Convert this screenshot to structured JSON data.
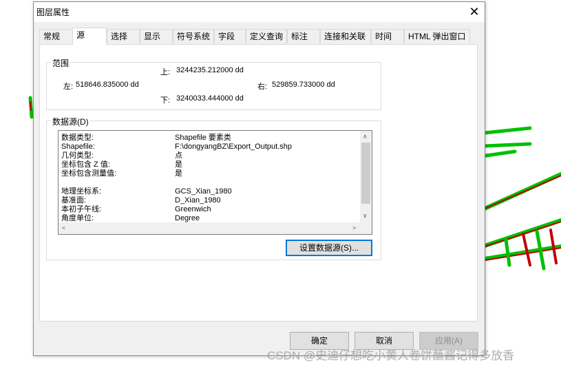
{
  "window": {
    "title": "图层属性"
  },
  "tabs": [
    {
      "label": "常规"
    },
    {
      "label": "源"
    },
    {
      "label": "选择"
    },
    {
      "label": "显示"
    },
    {
      "label": "符号系统"
    },
    {
      "label": "字段"
    },
    {
      "label": "定义查询"
    },
    {
      "label": "标注"
    },
    {
      "label": "连接和关联"
    },
    {
      "label": "时间"
    },
    {
      "label": "HTML 弹出窗口"
    }
  ],
  "active_tab": "源",
  "extent": {
    "label": "范围",
    "top_label": "上:",
    "top_value": "3244235.212000 dd",
    "left_label": "左:",
    "left_value": "518646.835000 dd",
    "right_label": "右:",
    "right_value": "529859.733000 dd",
    "bottom_label": "下:",
    "bottom_value": "3240033.444000 dd"
  },
  "datasource": {
    "label": "数据源(D)",
    "rows": [
      {
        "key": "数据类型:",
        "value": "Shapefile 要素类"
      },
      {
        "key": "Shapefile:",
        "value": "F:\\dongyangBZ\\Export_Output.shp"
      },
      {
        "key": "几何类型:",
        "value": "点"
      },
      {
        "key": "坐标包含 Z 值:",
        "value": "是"
      },
      {
        "key": "坐标包含测量值:",
        "value": "是"
      },
      {
        "key": "",
        "value": ""
      },
      {
        "key": "地理坐标系:",
        "value": "GCS_Xian_1980"
      },
      {
        "key": "基准面:",
        "value": "D_Xian_1980"
      },
      {
        "key": "本初子午线:",
        "value": "Greenwich"
      },
      {
        "key": "角度单位:",
        "value": "Degree"
      }
    ],
    "set_button": "设置数据源(S)..."
  },
  "buttons": {
    "ok": "确定",
    "cancel": "取消",
    "apply": "应用(A)"
  },
  "watermark": "CSDN @史迪仔想吃小黄人卷饼蘸酱记得多放香",
  "colors": {
    "map_green": "#00c000",
    "map_red": "#c00000",
    "focus_blue": "#0078d7"
  }
}
